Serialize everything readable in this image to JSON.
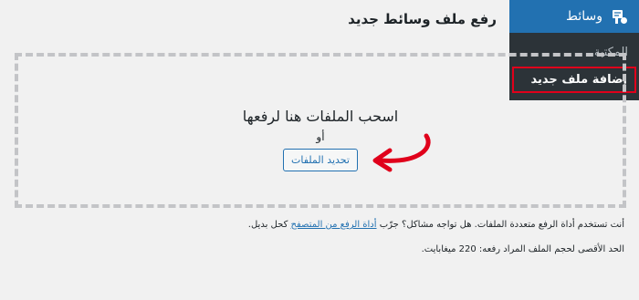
{
  "sidebar": {
    "menu_title": "وسائط",
    "icon": "media-icon",
    "items": [
      {
        "label": "المكتبة"
      },
      {
        "label": "إضافة ملف جديد"
      }
    ]
  },
  "page": {
    "title": "رفع ملف وسائط جديد"
  },
  "uploader": {
    "drop_heading": "اسحب الملفات هنا لرفعها",
    "or_label": "أو",
    "select_button": "تحديد الملفات"
  },
  "info": {
    "line1_prefix": "أنت تستخدم أداة الرفع متعددة الملفات. هل تواجه مشاكل؟ جرّب",
    "line1_link": "أداة الرفع من المتصفح",
    "line1_suffix": "كحل بديل.",
    "line2": "الحد الأقصى لحجم الملف المراد رفعه: 220 ميغابايت."
  },
  "colors": {
    "sidebar_bg": "#1d2327",
    "active_menu": "#2271b1",
    "highlight_border": "#e0001b",
    "link": "#2271b1",
    "annotation_arrow": "#e0001b"
  }
}
